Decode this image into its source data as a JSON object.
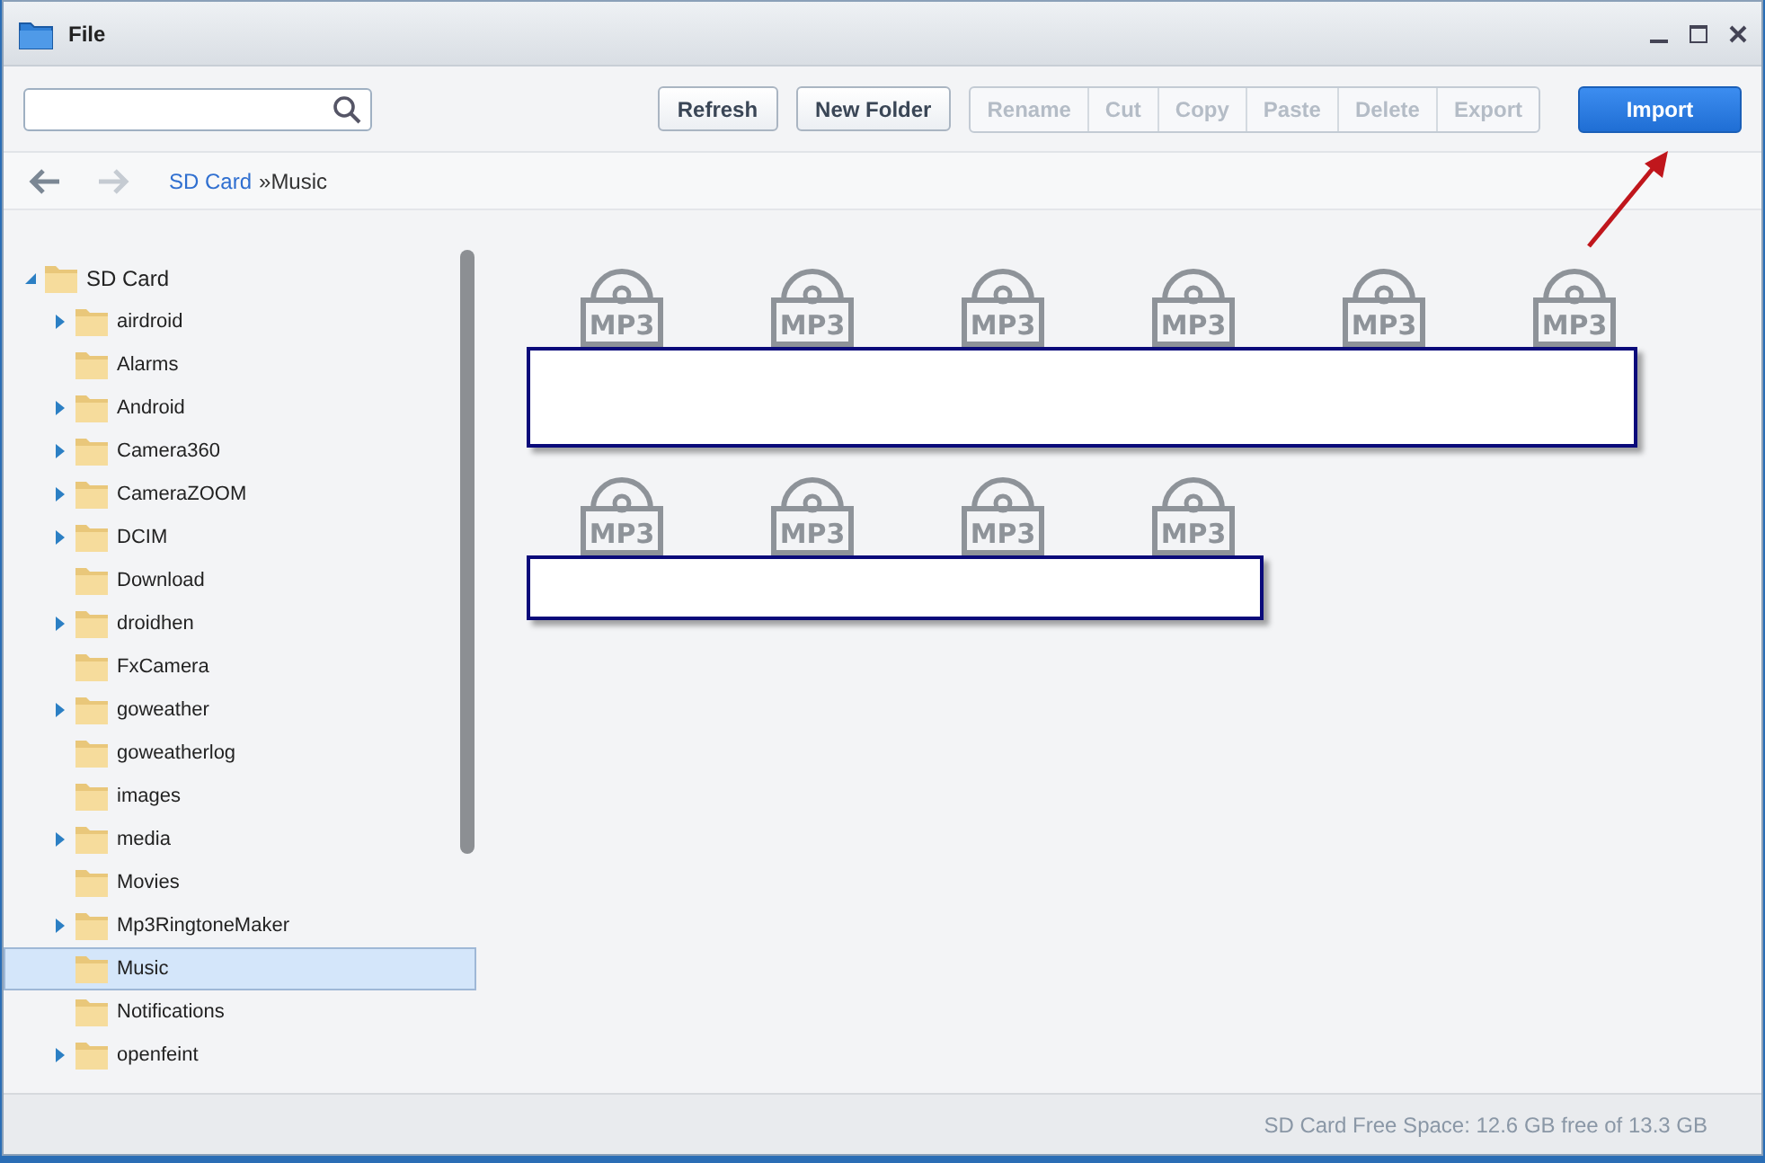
{
  "window": {
    "title": "File"
  },
  "toolbar": [
    {
      "label": "Refresh",
      "kind": "plain",
      "disabled": false
    },
    {
      "label": "New Folder",
      "kind": "plain",
      "disabled": false
    },
    {
      "label": "Rename",
      "kind": "segment",
      "disabled": true
    },
    {
      "label": "Cut",
      "kind": "segment",
      "disabled": true
    },
    {
      "label": "Copy",
      "kind": "segment",
      "disabled": true
    },
    {
      "label": "Paste",
      "kind": "segment",
      "disabled": true
    },
    {
      "label": "Delete",
      "kind": "segment",
      "disabled": true
    },
    {
      "label": "Export",
      "kind": "segment",
      "disabled": true
    },
    {
      "label": "Import",
      "kind": "primary",
      "disabled": false
    }
  ],
  "breadcrumb": [
    {
      "label": "SD Card",
      "kind": "link"
    },
    {
      "label": "»Music",
      "kind": "current"
    }
  ],
  "tree": {
    "label": "SD Card",
    "expanded": true,
    "children": [
      {
        "label": "airdroid",
        "expandable": true,
        "selected": false
      },
      {
        "label": "Alarms",
        "expandable": false,
        "selected": false
      },
      {
        "label": "Android",
        "expandable": true,
        "selected": false
      },
      {
        "label": "Camera360",
        "expandable": true,
        "selected": false
      },
      {
        "label": "CameraZOOM",
        "expandable": true,
        "selected": false
      },
      {
        "label": "DCIM",
        "expandable": true,
        "selected": false
      },
      {
        "label": "Download",
        "expandable": false,
        "selected": false
      },
      {
        "label": "droidhen",
        "expandable": true,
        "selected": false
      },
      {
        "label": "FxCamera",
        "expandable": false,
        "selected": false
      },
      {
        "label": "goweather",
        "expandable": true,
        "selected": false
      },
      {
        "label": "goweatherlog",
        "expandable": false,
        "selected": false
      },
      {
        "label": "images",
        "expandable": false,
        "selected": false
      },
      {
        "label": "media",
        "expandable": true,
        "selected": false
      },
      {
        "label": "Movies",
        "expandable": false,
        "selected": false
      },
      {
        "label": "Mp3RingtoneMaker",
        "expandable": true,
        "selected": false
      },
      {
        "label": "Music",
        "expandable": false,
        "selected": true
      },
      {
        "label": "Notifications",
        "expandable": false,
        "selected": false
      },
      {
        "label": "openfeint",
        "expandable": true,
        "selected": false
      }
    ]
  },
  "file_rows": [
    {
      "files": [
        "MP3",
        "MP3",
        "MP3",
        "MP3",
        "MP3",
        "MP3"
      ],
      "names_redacted": true
    },
    {
      "files": [
        "MP3",
        "MP3",
        "MP3",
        "MP3"
      ],
      "names_redacted": true
    }
  ],
  "status_bar": "SD Card Free Space: 12.6 GB free of 13.3 GB"
}
